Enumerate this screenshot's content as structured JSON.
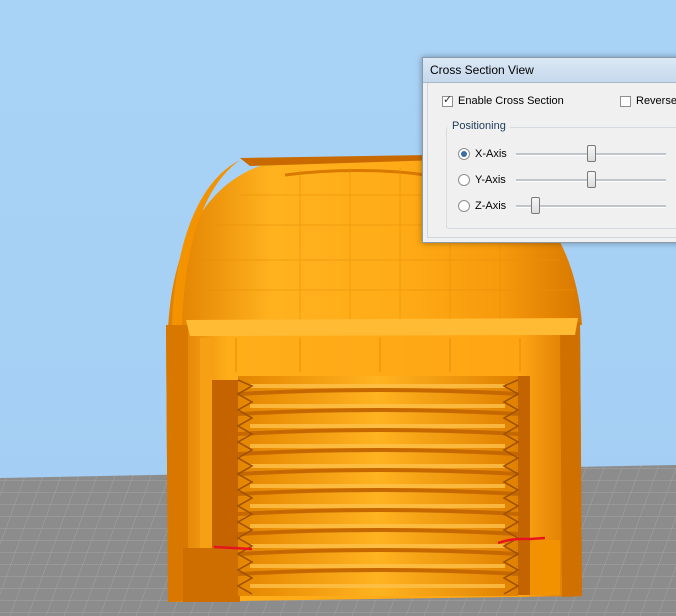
{
  "window": {
    "title": "Cross Section View",
    "enable_label": "Enable Cross Section",
    "enable_checked": true,
    "reverse_label": "Reverse",
    "reverse_checked": false,
    "positioning_label": "Positioning",
    "axes": [
      {
        "label": "X-Axis",
        "selected": true,
        "level": 0.5
      },
      {
        "label": "Y-Axis",
        "selected": false,
        "level": 0.5
      },
      {
        "label": "Z-Axis",
        "selected": false,
        "level": 0.13
      }
    ]
  },
  "scene": {
    "sky_color": "#a7d1f5",
    "floor_color": "#8e8e8e",
    "model_color": "#ffa21a",
    "marker_color": "#e8141d"
  }
}
